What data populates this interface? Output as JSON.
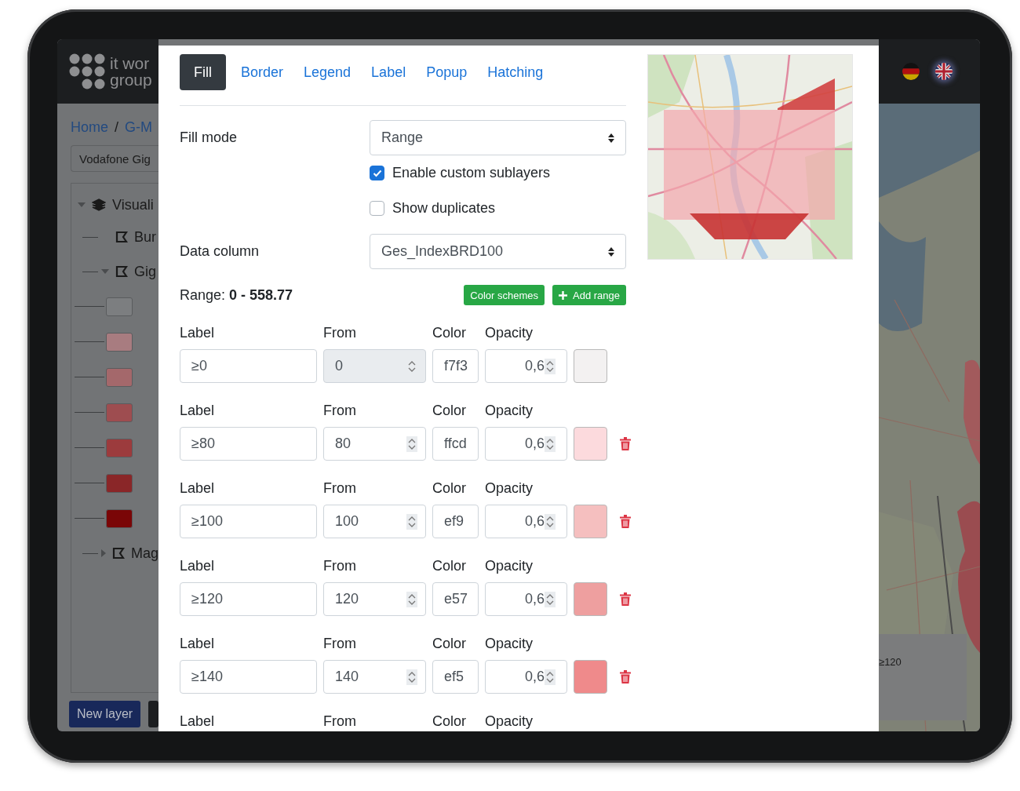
{
  "header": {
    "logo_lines": [
      "it wor",
      "group"
    ]
  },
  "breadcrumb": {
    "items": [
      {
        "label": "Home"
      },
      {
        "label": "G-M"
      }
    ],
    "separator": "/"
  },
  "project_select": {
    "value": "Vodafone Gig"
  },
  "layer_tree": [
    {
      "label": "Visuali",
      "kind": "group",
      "expanded": true,
      "children": [
        {
          "label": "Bur",
          "kind": "layer"
        },
        {
          "label": "Gig",
          "kind": "layer",
          "expanded": true,
          "children": [
            {
              "kind": "swatch",
              "color": "#7c7e80"
            },
            {
              "kind": "swatch",
              "color": "#a87c80"
            },
            {
              "kind": "swatch",
              "color": "#a4686b"
            },
            {
              "kind": "swatch",
              "color": "#9e4d50"
            },
            {
              "kind": "swatch",
              "color": "#9c3b3d"
            },
            {
              "kind": "swatch",
              "color": "#8a2628"
            },
            {
              "kind": "swatch",
              "color": "#7a0607"
            }
          ]
        },
        {
          "label": "Mag",
          "kind": "layer",
          "expanded": false
        }
      ]
    }
  ],
  "sidebar_buttons": [
    {
      "label": "New layer",
      "kind": "primary"
    },
    {
      "kind": "dark"
    }
  ],
  "languages": [
    {
      "kind": "de",
      "selected": false
    },
    {
      "kind": "gb",
      "selected": true
    }
  ],
  "map_legend": {
    "label": "≥120"
  },
  "modal": {
    "tabs": [
      {
        "label": "Fill",
        "selected": true
      },
      {
        "label": "Border",
        "selected": false
      },
      {
        "label": "Legend",
        "selected": false
      },
      {
        "label": "Label",
        "selected": false
      },
      {
        "label": "Popup",
        "selected": false
      },
      {
        "label": "Hatching",
        "selected": false
      }
    ],
    "fill_mode": {
      "label": "Fill mode",
      "value": "Range"
    },
    "options": [
      {
        "label": "Enable custom sublayers",
        "checked": true
      },
      {
        "label": "Show duplicates",
        "checked": false
      }
    ],
    "data_column": {
      "label": "Data column",
      "value": "Ges_IndexBRD100"
    },
    "range": "Range: **0 - 558.77**",
    "actions": [
      {
        "label": "Color schemes",
        "kind": "plain"
      },
      {
        "label": "Add range",
        "kind": "add"
      }
    ],
    "ranges": [
      {
        "headings": [
          "Label",
          "From",
          "Color",
          "Opacity"
        ],
        "label": "≥0",
        "from": "0",
        "from_disabled": true,
        "color_code": "f7f3",
        "opacity": "0,6",
        "color": "#f3f1f1",
        "removable": false
      },
      {
        "headings": [
          "Label",
          "From",
          "Color",
          "Opacity"
        ],
        "label": "≥80",
        "from": "80",
        "from_disabled": false,
        "color_code": "ffcd",
        "opacity": "0,6",
        "color": "#fcdadd",
        "removable": true
      },
      {
        "headings": [
          "Label",
          "From",
          "Color",
          "Opacity"
        ],
        "label": "≥100",
        "from": "100",
        "from_disabled": false,
        "color_code": "ef9",
        "opacity": "0,6",
        "color": "#f5bfbf",
        "removable": true
      },
      {
        "headings": [
          "Label",
          "From",
          "Color",
          "Opacity"
        ],
        "label": "≥120",
        "from": "120",
        "from_disabled": false,
        "color_code": "e57",
        "opacity": "0,6",
        "color": "#ee9f9f",
        "removable": true
      },
      {
        "headings": [
          "Label",
          "From",
          "Color",
          "Opacity"
        ],
        "label": "≥140",
        "from": "140",
        "from_disabled": false,
        "color_code": "ef5",
        "opacity": "0,6",
        "color": "#ef8a8b",
        "removable": true
      }
    ],
    "next_row_headings": [
      "Label",
      "From",
      "Color",
      "Opacity"
    ]
  }
}
